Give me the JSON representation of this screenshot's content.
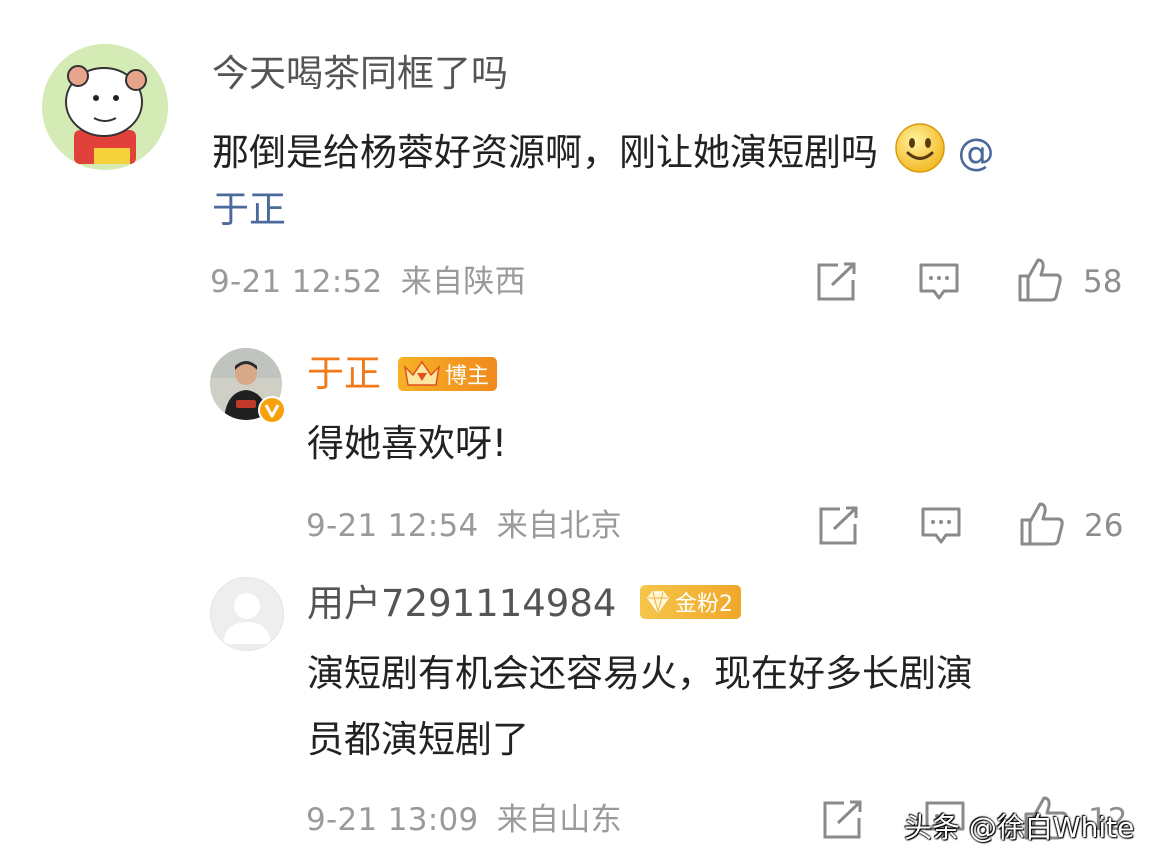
{
  "comments": [
    {
      "username": "今天喝茶同框了吗",
      "text_line1": "那倒是给杨蓉好资源啊，刚让她演短剧吗",
      "mention_at": "@",
      "mention_name": "于正",
      "timestamp": "9-21 12:52",
      "location": "来自陕西",
      "likes": "58"
    },
    {
      "username": "于正",
      "badge": "博主",
      "text": "得她喜欢呀!",
      "timestamp": "9-21 12:54",
      "location": "来自北京",
      "likes": "26"
    },
    {
      "username": "用户7291114984",
      "badge": "金粉2",
      "text_line1": "演短剧有机会还容易火，现在好多长剧演",
      "text_line2": "员都演短剧了",
      "timestamp": "9-21 13:09",
      "location": "来自山东",
      "likes": "12"
    }
  ],
  "watermark": "头条 @徐白White",
  "colors": {
    "orange_name": "#f07a1a",
    "mention_blue": "#4b6a9b",
    "meta_gray": "#9a9a9a"
  }
}
